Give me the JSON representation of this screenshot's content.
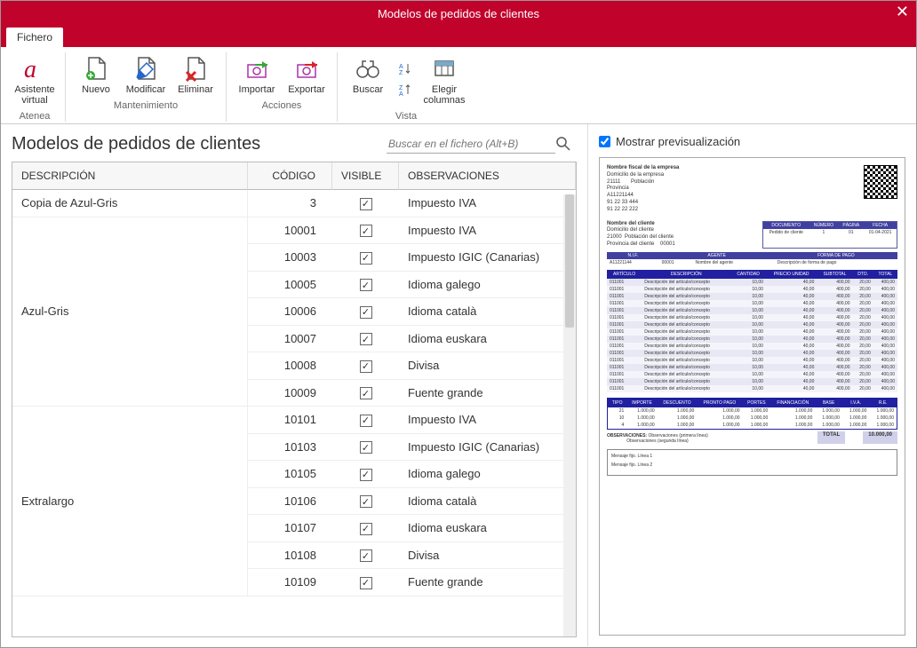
{
  "window": {
    "title": "Modelos de pedidos de clientes"
  },
  "tabs": {
    "fichero": "Fichero"
  },
  "ribbon": {
    "groups": {
      "atenea": {
        "label": "Atenea",
        "asistente": "Asistente\nvirtual"
      },
      "mantenimiento": {
        "label": "Mantenimiento",
        "nuevo": "Nuevo",
        "modificar": "Modificar",
        "eliminar": "Eliminar"
      },
      "acciones": {
        "label": "Acciones",
        "importar": "Importar",
        "exportar": "Exportar"
      },
      "vista": {
        "label": "Vista",
        "buscar": "Buscar",
        "elegir": "Elegir\ncolumnas"
      }
    }
  },
  "page": {
    "heading": "Modelos de pedidos de clientes",
    "search_placeholder": "Buscar en el fichero (Alt+B)"
  },
  "table": {
    "headers": {
      "descripcion": "DESCRIPCIÓN",
      "codigo": "CÓDIGO",
      "visible": "VISIBLE",
      "observaciones": "OBSERVACIONES"
    },
    "groups": [
      {
        "desc": "Copia de Azul-Gris",
        "rows": [
          {
            "code": "3",
            "obs": "Impuesto IVA"
          }
        ],
        "selected": true
      },
      {
        "desc": "Azul-Gris",
        "rows": [
          {
            "code": "10001",
            "obs": "Impuesto IVA"
          },
          {
            "code": "10003",
            "obs": "Impuesto IGIC (Canarias)"
          },
          {
            "code": "10005",
            "obs": "Idioma galego"
          },
          {
            "code": "10006",
            "obs": "Idioma català"
          },
          {
            "code": "10007",
            "obs": "Idioma euskara"
          },
          {
            "code": "10008",
            "obs": "Divisa"
          },
          {
            "code": "10009",
            "obs": "Fuente grande"
          }
        ]
      },
      {
        "desc": "Extralargo",
        "rows": [
          {
            "code": "10101",
            "obs": "Impuesto IVA"
          },
          {
            "code": "10103",
            "obs": "Impuesto IGIC (Canarias)"
          },
          {
            "code": "10105",
            "obs": "Idioma galego"
          },
          {
            "code": "10106",
            "obs": "Idioma català"
          },
          {
            "code": "10107",
            "obs": "Idioma euskara"
          },
          {
            "code": "10108",
            "obs": "Divisa"
          },
          {
            "code": "10109",
            "obs": "Fuente grande"
          }
        ]
      }
    ]
  },
  "right": {
    "show_preview": "Mostrar previsualización"
  },
  "preview": {
    "company": {
      "name": "Nombre fiscal de la empresa",
      "addr": "Domicilio de la empresa",
      "cp": "21111",
      "poblacion": "Población",
      "provincia": "Provincia",
      "nif": "A11221144",
      "tel1": "91 22 33 444",
      "tel2": "91 22 22 222"
    },
    "client": {
      "name": "Nombre del cliente",
      "addr": "Domicilio del cliente",
      "cp": "21000",
      "poblacion": "Población del cliente",
      "provincia": "Provincia del cliente",
      "code": "00001"
    },
    "docbox": {
      "h_doc": "DOCUMENTO",
      "h_num": "NÚMERO",
      "h_pag": "PÁGINA",
      "h_fecha": "FECHA",
      "doc": "Pedido de cliente",
      "num": "1",
      "pag": "01",
      "fecha": "01-04-2021"
    },
    "band": {
      "h_nif": "N.I.F.",
      "h_agente": "AGENTE",
      "h_forma": "FORMA DE PAGO",
      "nif": "A11221144",
      "agcode": "00001",
      "agente": "Nombre del agente",
      "forma": "Descripción de forma de pago"
    },
    "items": {
      "h_art": "ARTÍCULO",
      "h_desc": "DESCRIPCIÓN",
      "h_cant": "CANTIDAD",
      "h_pu": "PRECIO UNIDAD",
      "h_sub": "SUBTOTAL",
      "h_dto": "DTO.",
      "h_tot": "TOTAL",
      "art": "011001",
      "desc": "Descripción del artículo/concepto",
      "cant": "10,00",
      "pu": "40,00",
      "sub": "400,00",
      "dto": "20,00",
      "tot": "400,00",
      "count": 16
    },
    "totals": {
      "h_tipo": "TIPO",
      "h_imp": "IMPORTE",
      "h_desc": "DESCUENTO",
      "h_pp": "PRONTO PAGO",
      "h_port": "PORTES",
      "h_fin": "FINANCIACIÓN",
      "h_base": "BASE",
      "h_iva": "I.V.A.",
      "h_re": "R.E.",
      "rows": [
        [
          "21",
          "1.000,00",
          "1.000,00",
          "1.000,00",
          "1.000,00",
          "1.000,00",
          "1.000,00",
          "1.000,00",
          "1.000,00"
        ],
        [
          "10",
          "1.000,00",
          "1.000,00",
          "1.000,00",
          "1.000,00",
          "1.000,00",
          "1.000,00",
          "1.000,00",
          "1.000,00"
        ],
        [
          "4",
          "1.000,00",
          "1.000,00",
          "1.000,00",
          "1.000,00",
          "1.000,00",
          "1.000,00",
          "1.000,00",
          "1.000,00"
        ]
      ]
    },
    "obs_label": "OBSERVACIONES:",
    "obs1": "Observaciones (primera línea)",
    "obs2": "Observaciones (segunda línea)",
    "total_label": "TOTAL",
    "total_value": "10.000,00",
    "msg1": "Mensaje fijo. Línea 1",
    "msg2": "Mensaje fijo. Línea 2"
  }
}
